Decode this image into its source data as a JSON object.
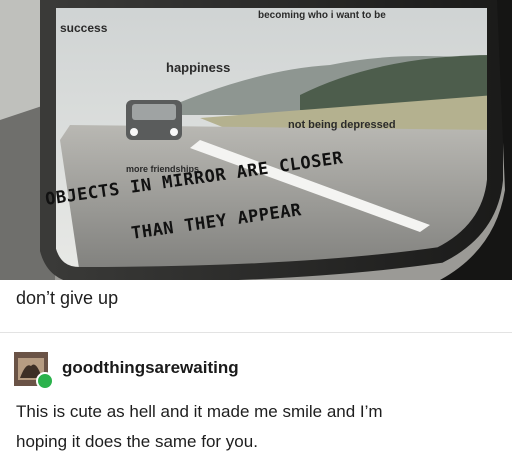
{
  "image": {
    "captions": {
      "success": "success",
      "becoming": "becoming who i want to be",
      "happiness": "happiness",
      "not_depressed": "not being depressed",
      "friendships": "more friendships"
    },
    "mirror_warning": {
      "line1": "OBJECTS IN MIRROR ARE CLOSER",
      "line2": "THAN THEY APPEAR"
    }
  },
  "post": {
    "body": "don’t give up"
  },
  "reply": {
    "username": "goodthingsarewaiting",
    "text_line1": "This is cute as hell and it made me smile and I’m",
    "text_line2": "hoping it does the same for you."
  },
  "colors": {
    "reblog_badge": "#2bb24c",
    "divider": "#e3e3e3"
  }
}
